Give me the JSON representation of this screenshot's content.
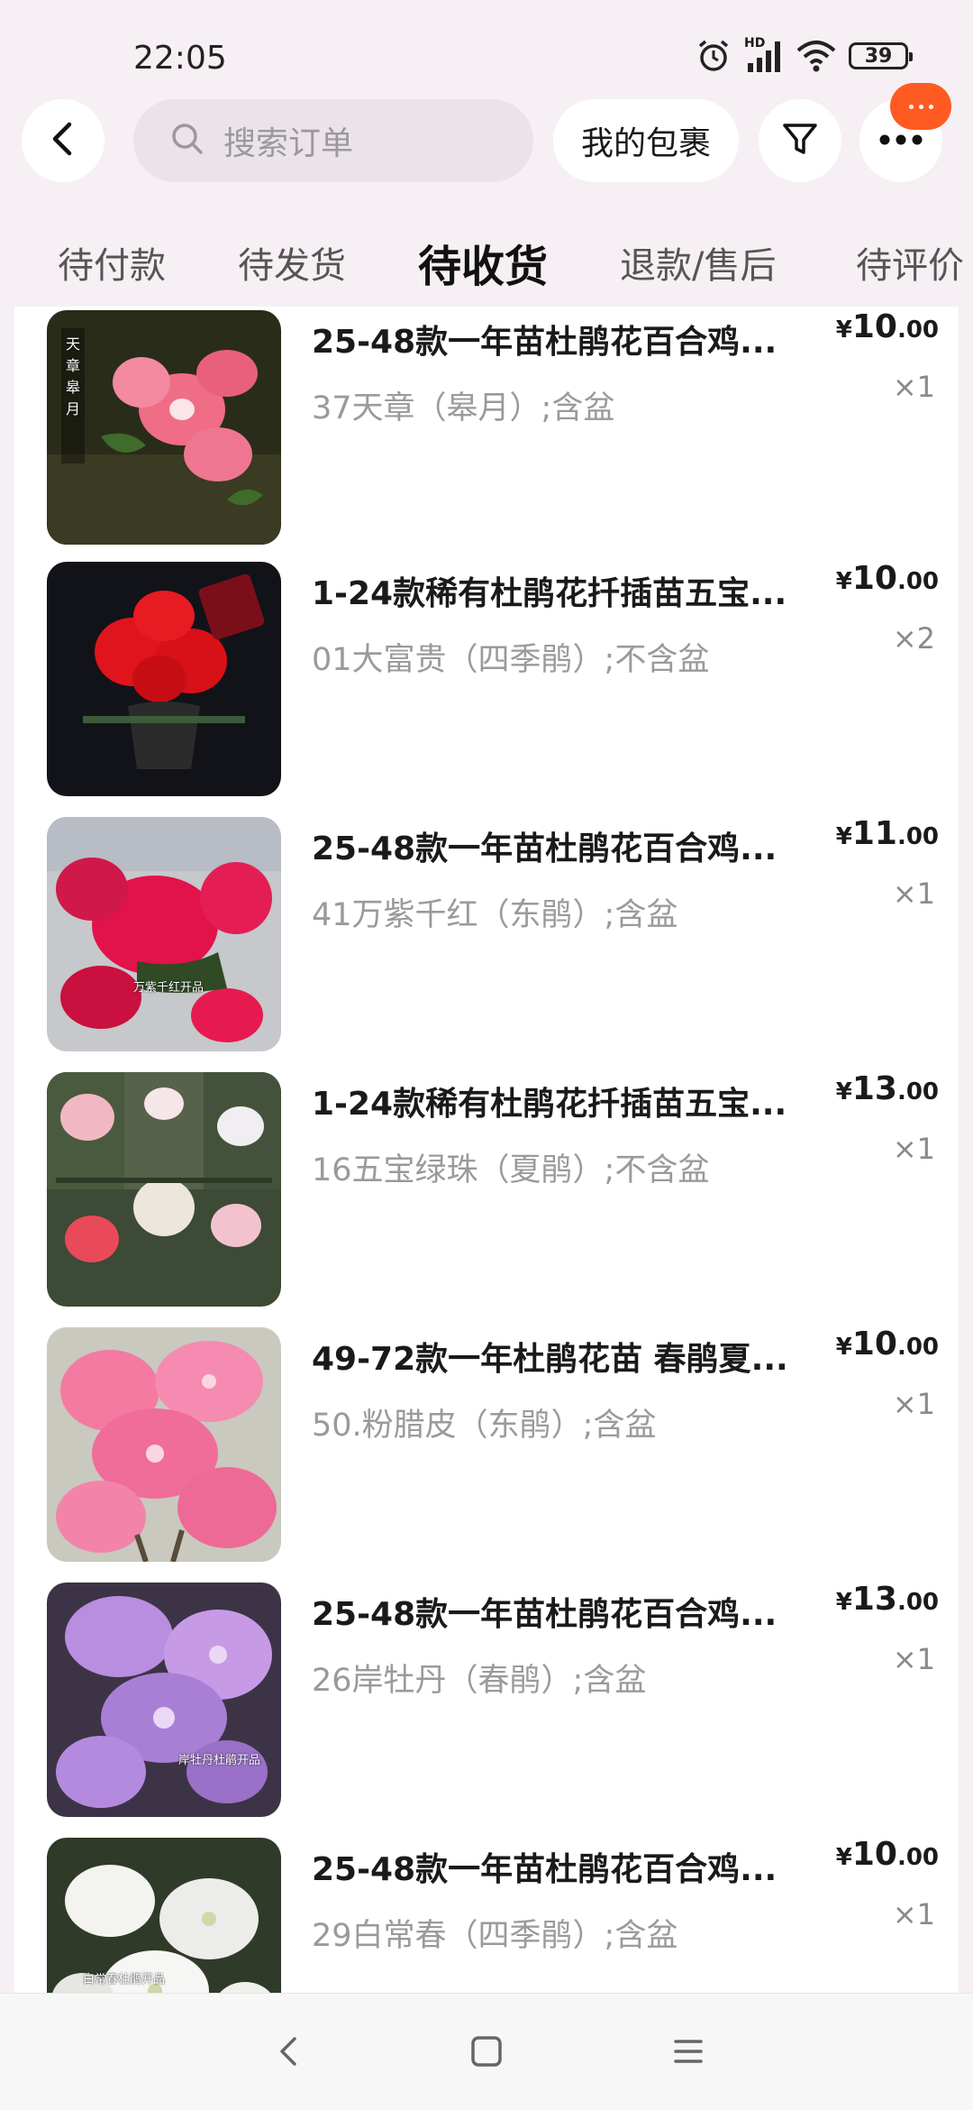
{
  "status_bar": {
    "time": "22:05",
    "hd_label": "HD",
    "battery": "39",
    "icons": [
      "alarm-icon",
      "signal-icon",
      "wifi-icon",
      "battery-icon"
    ]
  },
  "top_nav": {
    "search_placeholder": "搜索订单",
    "packages_label": "我的包裹",
    "icons": [
      "back-icon",
      "search-icon",
      "filter-icon",
      "more-icon"
    ]
  },
  "tabs": [
    {
      "label": "待付款",
      "active": false
    },
    {
      "label": "待发货",
      "active": false
    },
    {
      "label": "待收货",
      "active": true
    },
    {
      "label": "退款/售后",
      "active": false
    },
    {
      "label": "待评价",
      "active": false
    }
  ],
  "items": [
    {
      "title": "25-48款一年苗杜鹃花百合鸡...",
      "spec": "37天章（皋月）;含盆",
      "currency": "¥",
      "price_int": "10",
      "price_dec": ".00",
      "qty": "×1",
      "photo_text": "天章皋月"
    },
    {
      "title": "1-24款稀有杜鹃花扦插苗五宝...",
      "spec": "01大富贵（四季鹃）;不含盆",
      "currency": "¥",
      "price_int": "10",
      "price_dec": ".00",
      "qty": "×2",
      "photo_text": ""
    },
    {
      "title": "25-48款一年苗杜鹃花百合鸡...",
      "spec": "41万紫千红（东鹃）;含盆",
      "currency": "¥",
      "price_int": "11",
      "price_dec": ".00",
      "qty": "×1",
      "photo_text": "万紫千红开品"
    },
    {
      "title": "1-24款稀有杜鹃花扦插苗五宝...",
      "spec": "16五宝绿珠（夏鹃）;不含盆",
      "currency": "¥",
      "price_int": "13",
      "price_dec": ".00",
      "qty": "×1",
      "photo_text": ""
    },
    {
      "title": "49-72款一年杜鹃花苗 春鹃夏...",
      "spec": "50.粉腊皮（东鹃）;含盆",
      "currency": "¥",
      "price_int": "10",
      "price_dec": ".00",
      "qty": "×1",
      "photo_text": ""
    },
    {
      "title": "25-48款一年苗杜鹃花百合鸡...",
      "spec": "26岸牡丹（春鹃）;含盆",
      "currency": "¥",
      "price_int": "13",
      "price_dec": ".00",
      "qty": "×1",
      "photo_text": "岸牡丹杜鹃开品"
    },
    {
      "title": "25-48款一年苗杜鹃花百合鸡...",
      "spec": "29白常春（四季鹃）;含盆",
      "currency": "¥",
      "price_int": "10",
      "price_dec": ".00",
      "qty": "×1",
      "photo_text": "白常春杜鹃开品"
    }
  ],
  "bottom_nav": [
    "nav-back-icon",
    "nav-home-icon",
    "nav-menu-icon"
  ],
  "colors": {
    "background": "#f6eff4",
    "card": "#ffffff",
    "badge": "#ff5a22",
    "muted_text": "#9a9a9a"
  }
}
